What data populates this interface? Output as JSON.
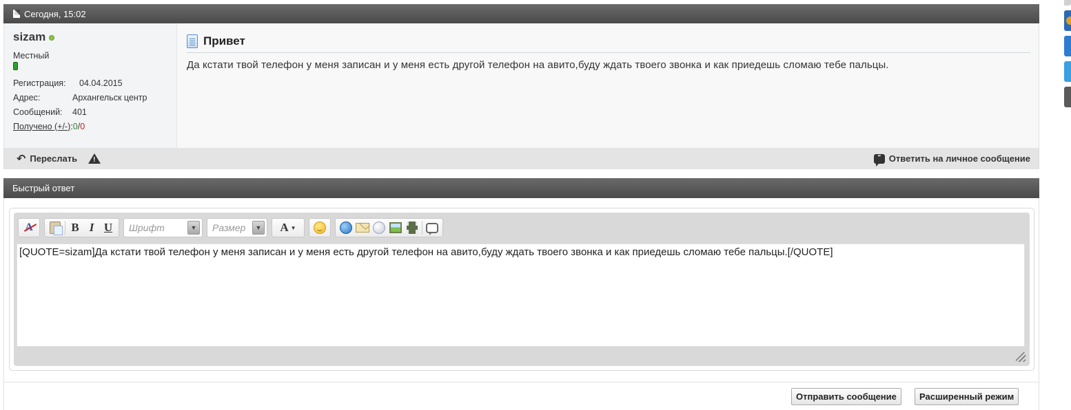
{
  "post": {
    "date": "Сегодня, 15:02",
    "user": {
      "name": "sizam",
      "title": "Местный",
      "reg_label": "Регистрация:",
      "reg_value": "04.04.2015",
      "address_label": "Адрес:",
      "address_value": "Архангельск центр",
      "messages_label": "Сообщений:",
      "messages_value": "401",
      "received_label": "Получено (+/-)",
      "received_sep": ": ",
      "received_plus": "0",
      "received_slash": "/",
      "received_minus": "0"
    },
    "message": {
      "title": "Привет",
      "text": "Да кстати твой телефон у меня записан и у меня есть другой телефон на авито,буду ждать твоего звонка и как приедешь сломаю тебе пальцы."
    },
    "footer": {
      "forward_label": "Переслать",
      "reply_label": "Ответить на личное сообщение"
    }
  },
  "quick_reply": {
    "title": "Быстрый ответ",
    "toolbar": {
      "font_placeholder": "Шрифт",
      "size_placeholder": "Размер",
      "bold": "B",
      "italic": "I",
      "underline": "U",
      "font_color": "A"
    },
    "textarea_value": "[QUOTE=sizam]Да кстати твой телефон у меня записан и у меня есть другой телефон на авито,буду ждать твоего звонка и как приедешь сломаю тебе пальцы.[/QUOTE]",
    "send_label": "Отправить сообщение",
    "advanced_label": "Расширенный режим"
  }
}
